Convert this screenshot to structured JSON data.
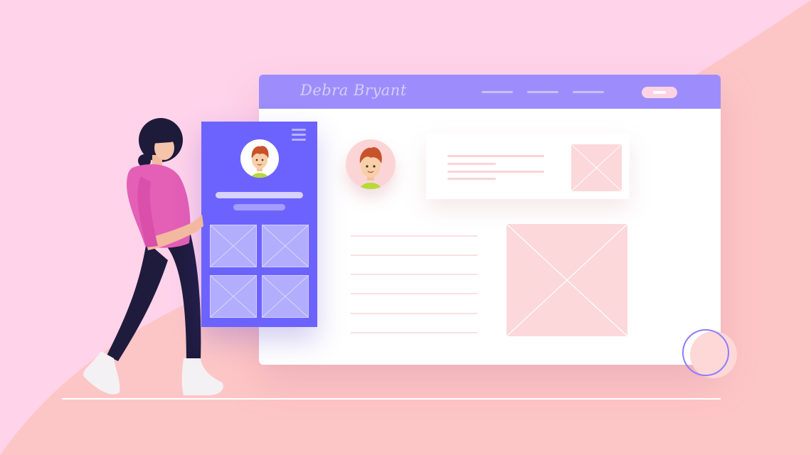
{
  "header": {
    "brand_name": "Debra Bryant"
  },
  "colors": {
    "background_pink": "#ffd3ea",
    "background_wave": "#fdc6c6",
    "header_purple": "#9d8dfc",
    "phone_purple": "#6c63ff",
    "placeholder_pink": "#fcd8da",
    "shirt_magenta": "#e45fb6",
    "pants_navy": "#1f1b3d"
  },
  "icons": {
    "menu": "hamburger-menu-icon",
    "image_placeholder": "image-placeholder-icon",
    "avatar": "avatar-icon"
  }
}
